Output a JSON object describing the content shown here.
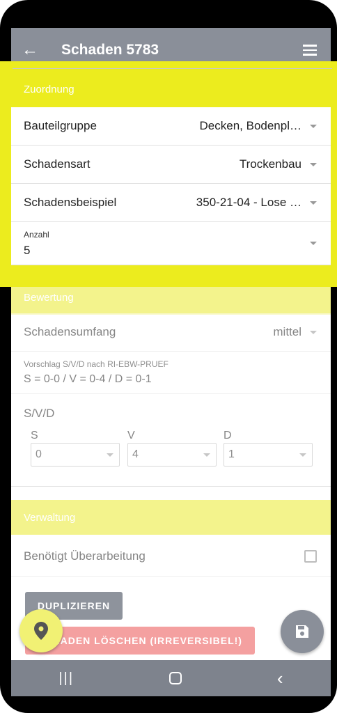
{
  "appbar": {
    "title": "Schaden 5783",
    "back_icon": "arrow-left-icon",
    "menu_icon": "hamburger-icon"
  },
  "zuordnung": {
    "heading": "Zuordnung",
    "rows": [
      {
        "label": "Bauteilgruppe",
        "value": "Decken, Bodenpl…"
      },
      {
        "label": "Schadensart",
        "value": "Trockenbau"
      },
      {
        "label": "Schadensbeispiel",
        "value": "350-21-04 - Lose …"
      }
    ],
    "anzahl": {
      "label": "Anzahl",
      "value": "5"
    }
  },
  "bewertung": {
    "heading": "Bewertung",
    "schadensumfang": {
      "label": "Schadensumfang",
      "value": "mittel"
    },
    "vorschlag": {
      "label": "Vorschlag S/V/D nach RI-EBW-PRUEF",
      "value": "S = 0-0 / V = 0-4  / D = 0-1"
    },
    "svd": {
      "label": "S/V/D",
      "s": {
        "label": "S",
        "value": "0"
      },
      "v": {
        "label": "V",
        "value": "4"
      },
      "d": {
        "label": "D",
        "value": "1"
      }
    }
  },
  "verwaltung": {
    "heading": "Verwaltung",
    "ueberarbeitung": {
      "label": "Benötigt Überarbeitung",
      "checked": false
    }
  },
  "buttons": {
    "duplizieren": "DUPLIZIEREN",
    "loeschen": "SCHADEN LÖSCHEN (IRREVERSIBEL!)"
  },
  "colors": {
    "highlight": "#ecec1e",
    "section": "#f3f38c",
    "appbar": "#8a8f99",
    "delete": "#f4a0a0"
  }
}
